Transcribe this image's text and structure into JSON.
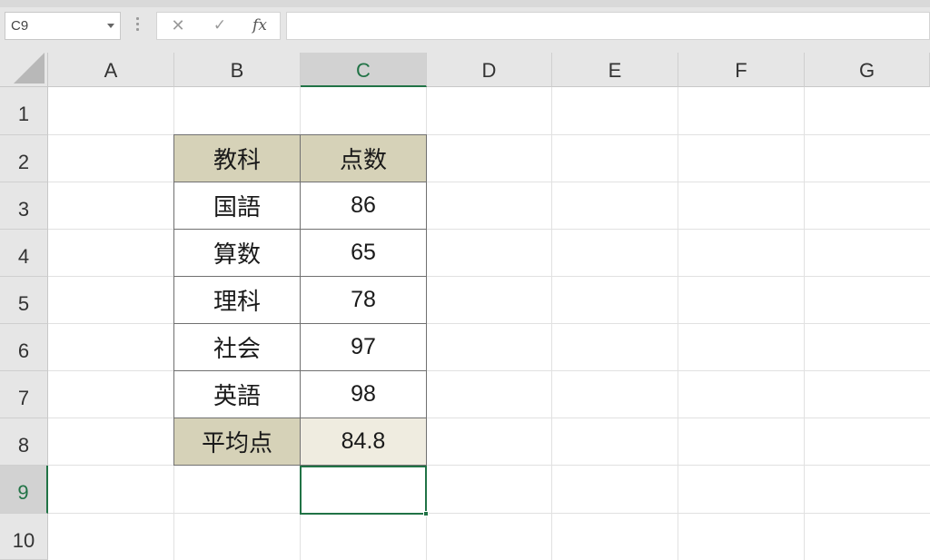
{
  "formula_bar": {
    "name_box": "C9",
    "cancel_icon": "✕",
    "enter_icon": "✓",
    "fx_label": "fx",
    "formula": ""
  },
  "columns": [
    "A",
    "B",
    "C",
    "D",
    "E",
    "F",
    "G"
  ],
  "rows": [
    "1",
    "2",
    "3",
    "4",
    "5",
    "6",
    "7",
    "8",
    "9",
    "10"
  ],
  "selection": {
    "column": "C",
    "row": "9"
  },
  "table": {
    "header": {
      "subject": "教科",
      "score": "点数"
    },
    "rows": [
      {
        "subject": "国語",
        "score": "86"
      },
      {
        "subject": "算数",
        "score": "65"
      },
      {
        "subject": "理科",
        "score": "78"
      },
      {
        "subject": "社会",
        "score": "97"
      },
      {
        "subject": "英語",
        "score": "98"
      }
    ],
    "footer": {
      "label": "平均点",
      "value": "84.8"
    }
  },
  "colors": {
    "header_fill": "#d6d2b8",
    "footer_value_fill": "#efece0",
    "selection_accent": "#217346"
  }
}
